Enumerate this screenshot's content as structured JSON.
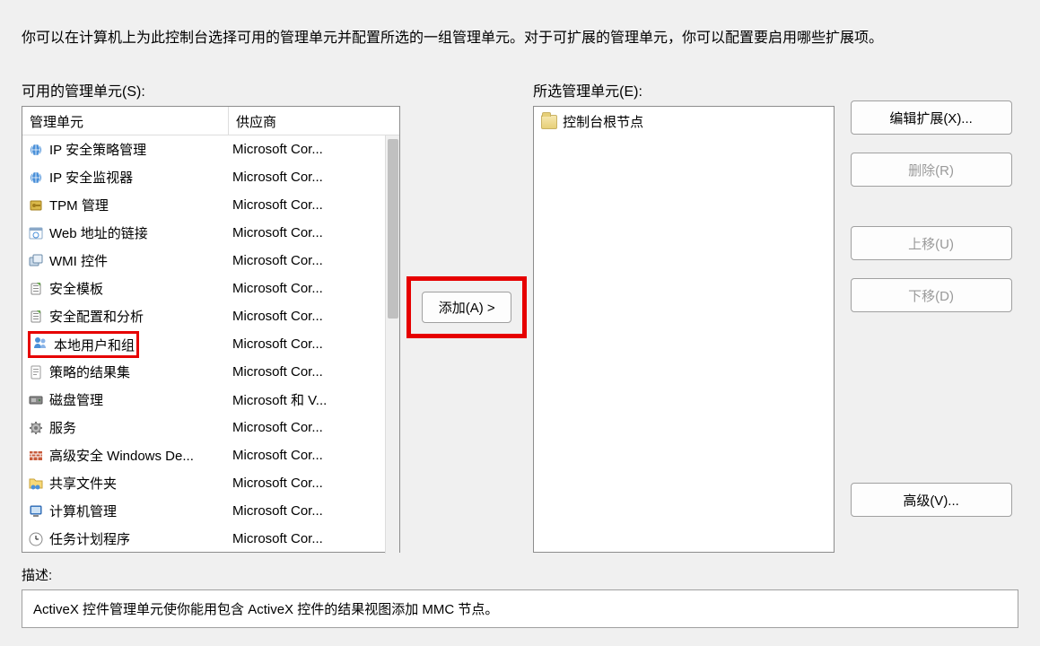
{
  "intro": "你可以在计算机上为此控制台选择可用的管理单元并配置所选的一组管理单元。对于可扩展的管理单元，你可以配置要启用哪些扩展项。",
  "avail": {
    "label": "可用的管理单元(S):",
    "columns": {
      "name": "管理单元",
      "vendor": "供应商"
    },
    "items": [
      {
        "icon": "shield-globe-icon",
        "name": "IP 安全策略管理",
        "vendor": "Microsoft Cor..."
      },
      {
        "icon": "shield-globe-icon",
        "name": "IP 安全监视器",
        "vendor": "Microsoft Cor..."
      },
      {
        "icon": "chip-key-icon",
        "name": "TPM 管理",
        "vendor": "Microsoft Cor..."
      },
      {
        "icon": "web-link-icon",
        "name": "Web 地址的链接",
        "vendor": "Microsoft Cor..."
      },
      {
        "icon": "wmi-icon",
        "name": "WMI 控件",
        "vendor": "Microsoft Cor..."
      },
      {
        "icon": "template-icon",
        "name": "安全模板",
        "vendor": "Microsoft Cor..."
      },
      {
        "icon": "template-icon",
        "name": "安全配置和分析",
        "vendor": "Microsoft Cor..."
      },
      {
        "icon": "users-icon",
        "name": "本地用户和组",
        "vendor": "Microsoft Cor...",
        "highlight": true
      },
      {
        "icon": "policy-icon",
        "name": "策略的结果集",
        "vendor": "Microsoft Cor..."
      },
      {
        "icon": "disk-icon",
        "name": "磁盘管理",
        "vendor": "Microsoft 和 V..."
      },
      {
        "icon": "gear-icon",
        "name": "服务",
        "vendor": "Microsoft Cor..."
      },
      {
        "icon": "firewall-icon",
        "name": "高级安全 Windows De...",
        "vendor": "Microsoft Cor..."
      },
      {
        "icon": "shared-folder-icon",
        "name": "共享文件夹",
        "vendor": "Microsoft Cor..."
      },
      {
        "icon": "computer-icon",
        "name": "计算机管理",
        "vendor": "Microsoft Cor..."
      },
      {
        "icon": "clock-icon",
        "name": "任务计划程序",
        "vendor": "Microsoft Cor..."
      }
    ]
  },
  "selected": {
    "label": "所选管理单元(E):",
    "root": "控制台根节点"
  },
  "buttons": {
    "add": "添加(A) >",
    "edit_ext": "编辑扩展(X)...",
    "remove": "删除(R)",
    "move_up": "上移(U)",
    "move_down": "下移(D)",
    "advanced": "高级(V)..."
  },
  "description": {
    "label": "描述:",
    "text": "ActiveX 控件管理单元使你能用包含 ActiveX 控件的结果视图添加 MMC 节点。"
  }
}
